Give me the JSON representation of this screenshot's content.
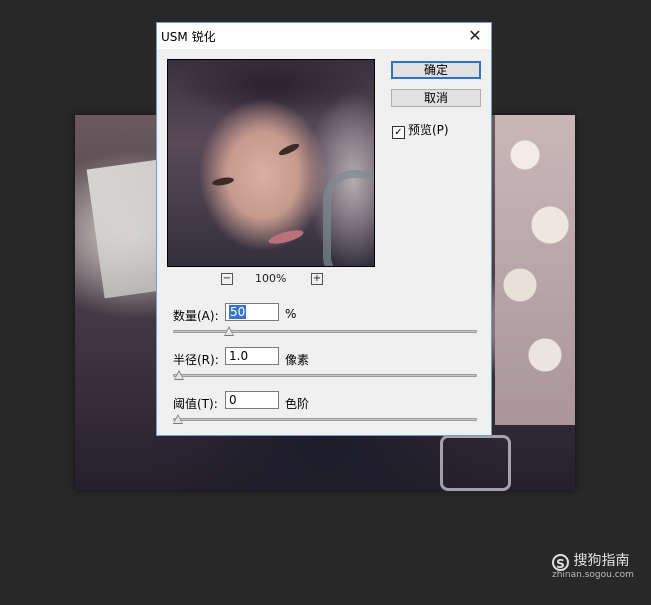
{
  "dialog": {
    "title": "USM 锐化",
    "close_glyph": "✕",
    "ok_label": "确定",
    "cancel_label": "取消",
    "preview_label": "预览(P)",
    "preview_checked": true,
    "checkbox_glyph": "✓",
    "zoom_minus": "−",
    "zoom_plus": "+",
    "zoom_value": "100%",
    "amount": {
      "label": "数量(A):",
      "value": "50",
      "unit": "%",
      "slider_fraction": 0.167
    },
    "radius": {
      "label": "半径(R):",
      "value": "1.0",
      "unit": "像素",
      "slider_fraction": 0.002
    },
    "threshold": {
      "label": "阈值(T):",
      "value": "0",
      "unit": "色阶",
      "slider_fraction": 0.0
    }
  },
  "watermark": {
    "logo_letter": "S",
    "brand": "搜狗指南",
    "url": "zhinan.sogou.com"
  }
}
